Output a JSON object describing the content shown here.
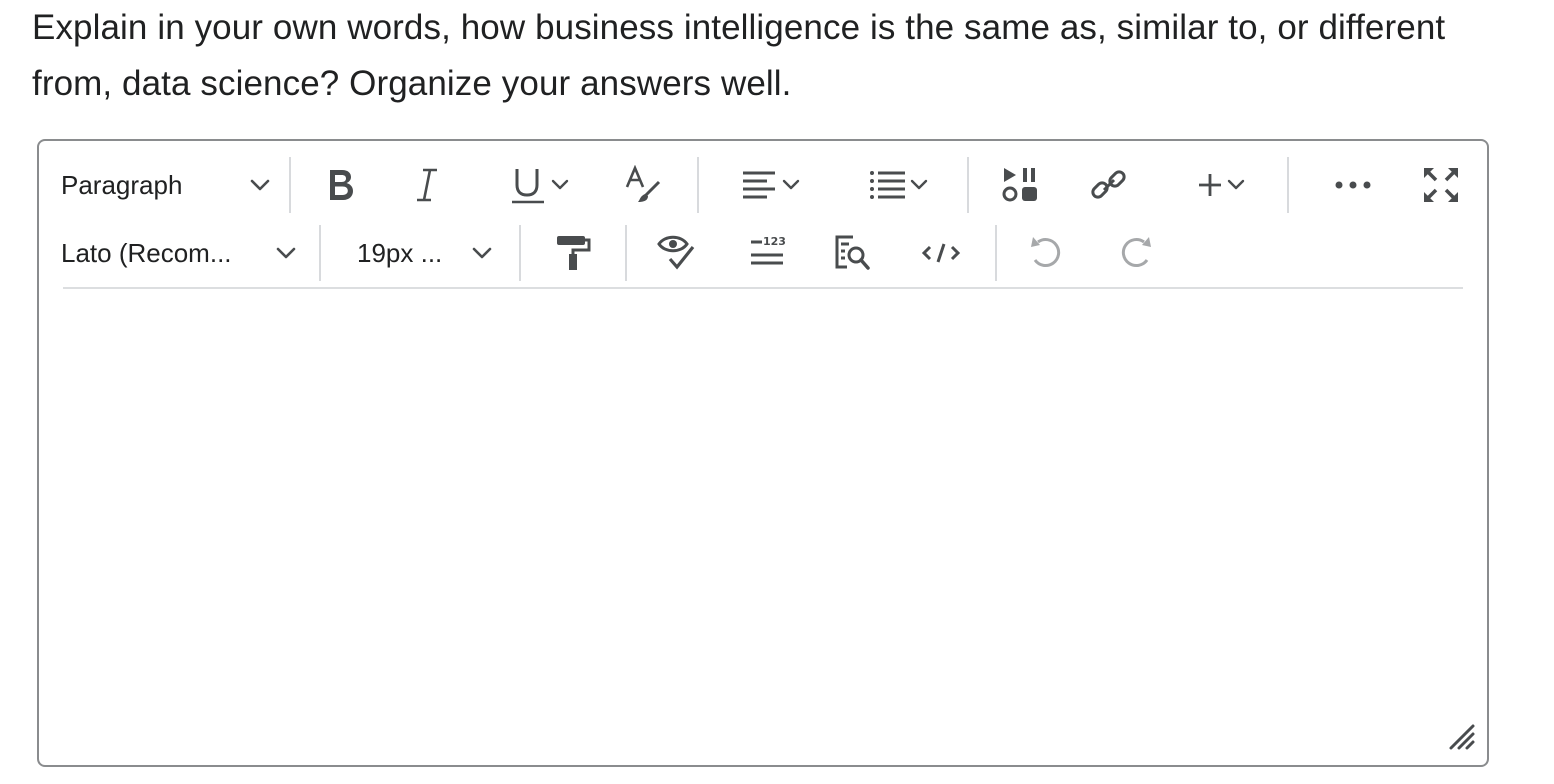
{
  "question": {
    "text": "Explain in your own words, how business intelligence is the same as, similar to, or different from, data science? Organize your answers well."
  },
  "toolbar": {
    "block_format": "Paragraph",
    "font_family": "Lato (Recom...",
    "font_size": "19px ...",
    "icons": {
      "bold": "bold-icon",
      "italic": "italic-icon",
      "underline": "underline-icon",
      "text_style": "text-style-icon",
      "align": "align-icon",
      "list": "bullet-list-icon",
      "media": "insert-media-icon",
      "link": "link-icon",
      "insert": "plus-icon",
      "more": "more-icon",
      "fullscreen": "fullscreen-icon",
      "format_painter": "format-painter-icon",
      "accessibility_check": "accessibility-check-icon",
      "word_count": "word-count-icon",
      "find_replace": "find-replace-icon",
      "source_code": "source-code-icon",
      "undo": "undo-icon",
      "redo": "redo-icon"
    }
  },
  "editor": {
    "content": ""
  },
  "colors": {
    "icon": "#494c4e",
    "disabled_icon": "#a6a8aa",
    "border": "#8a8c8e",
    "separator": "#d8dadd",
    "text": "#202122"
  }
}
